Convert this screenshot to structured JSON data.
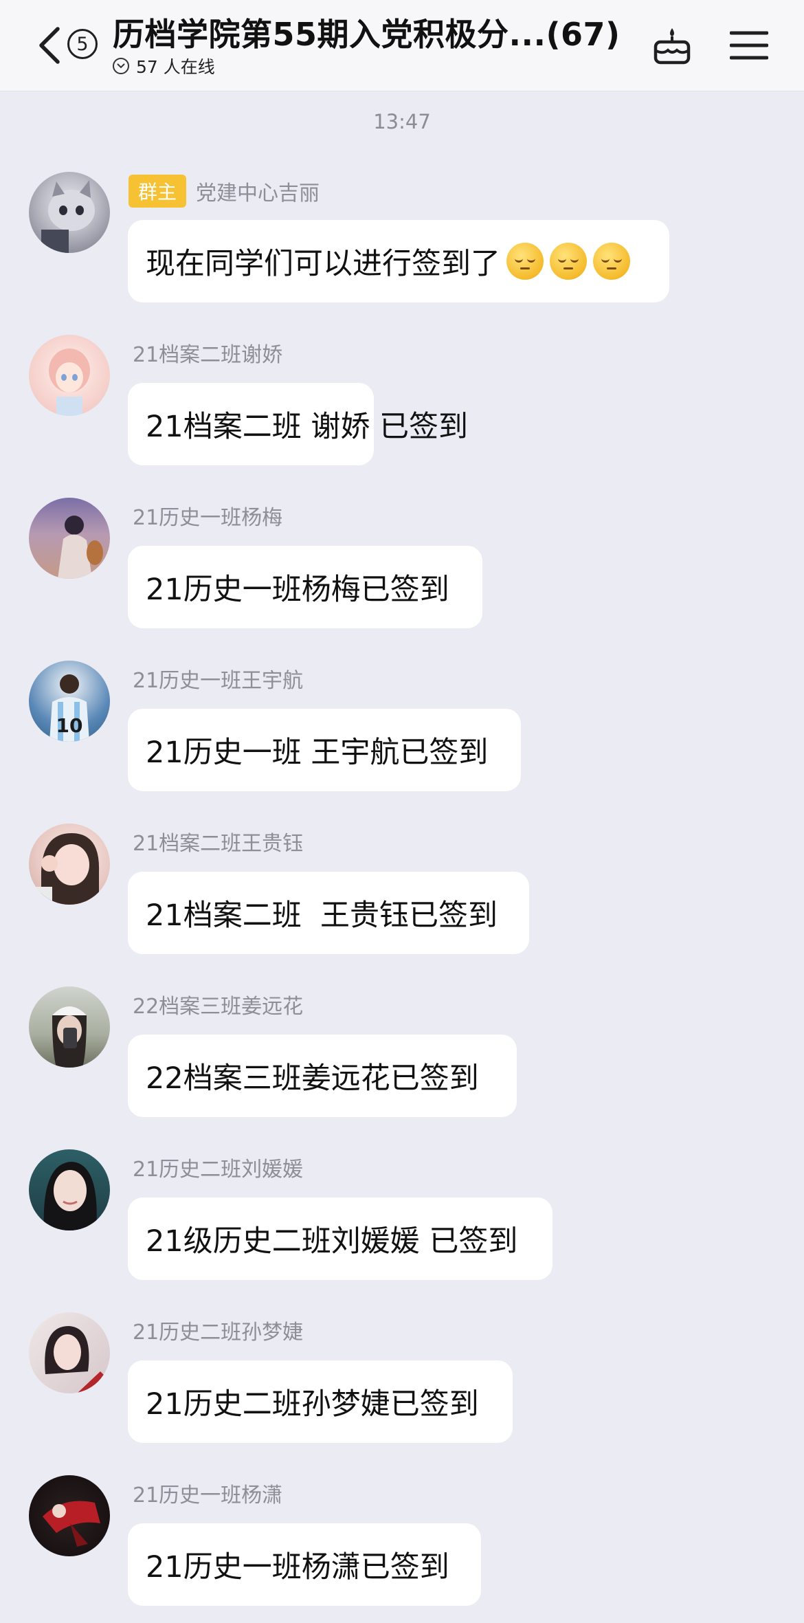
{
  "header": {
    "back_icon": "chevron-left-icon",
    "unread_count": "5",
    "title": "历档学院第55期入党积极分...(67)",
    "online_text": "57 人在线",
    "gift_icon": "cake-icon",
    "menu_icon": "menu-icon"
  },
  "timestamp": "13:47",
  "messages": [
    {
      "sender": "党建中心吉丽",
      "role": "群主",
      "text": "现在同学们可以进行签到了",
      "emoji": [
        "relieved-face-emoji",
        "relieved-face-emoji",
        "relieved-face-emoji"
      ],
      "avatar": "cat-avatar"
    },
    {
      "sender": "21档案二班谢娇",
      "text": "21档案二班 谢娇 已签到",
      "avatar": "anime-girl-avatar"
    },
    {
      "sender": "21历史一班杨梅",
      "text": "21历史一班杨梅已签到",
      "avatar": "girl-photo-avatar"
    },
    {
      "sender": "21历史一班王宇航",
      "text": "21历史一班 王宇航已签到",
      "avatar": "football-player-avatar"
    },
    {
      "sender": "21档案二班王贵钰",
      "text": "21档案二班  王贵钰已签到",
      "avatar": "girl-selfie-avatar"
    },
    {
      "sender": "22档案三班姜远花",
      "text": "22档案三班姜远花已签到",
      "avatar": "girl-cap-avatar"
    },
    {
      "sender": "21历史二班刘媛媛",
      "text": "21级历史二班刘媛媛 已签到",
      "avatar": "girl-portrait-avatar"
    },
    {
      "sender": "21历史二班孙梦婕",
      "text": "21历史二班孙梦婕已签到",
      "avatar": "girl-red-avatar"
    },
    {
      "sender": "21历史一班杨潇",
      "text": "21历史一班杨潇已签到",
      "avatar": "figure-red-avatar"
    }
  ],
  "colors": {
    "background": "#ebebf4",
    "header_bg": "#f7f7fa",
    "bubble": "#ffffff",
    "sender_text": "#8e8e96",
    "owner_badge": "#f6c233"
  }
}
